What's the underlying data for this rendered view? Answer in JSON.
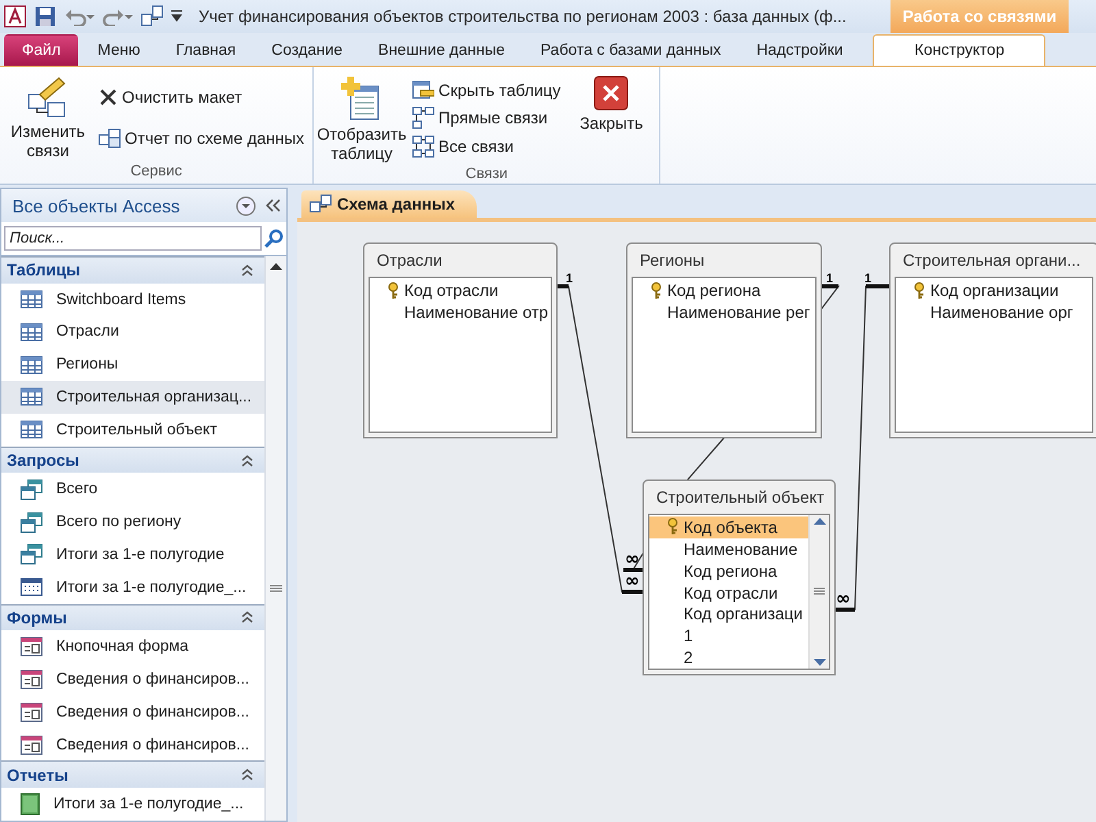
{
  "title_bar": {
    "title": "Учет финансирования объектов строительства по регионам 2003 : база данных (ф...",
    "context_tab": "Работа со связями"
  },
  "tabs": [
    {
      "label": "Файл",
      "kind": "file",
      "selected": false
    },
    {
      "label": "Меню",
      "kind": "tab",
      "selected": false
    },
    {
      "label": "Главная",
      "kind": "tab",
      "selected": false
    },
    {
      "label": "Создание",
      "kind": "tab",
      "selected": false
    },
    {
      "label": "Внешние данные",
      "kind": "tab",
      "selected": false
    },
    {
      "label": "Работа с базами данных",
      "kind": "tab",
      "selected": false
    },
    {
      "label": "Надстройки",
      "kind": "tab",
      "selected": false
    },
    {
      "label": "Конструктор",
      "kind": "tab",
      "selected": true
    }
  ],
  "ribbon": {
    "groups": [
      {
        "label": "Сервис",
        "buttons": [
          {
            "label": "Изменить связи",
            "kind": "large"
          },
          {
            "label": "Очистить макет",
            "kind": "small"
          },
          {
            "label": "Отчет по схеме данных",
            "kind": "small"
          }
        ]
      },
      {
        "label": "Связи",
        "buttons": [
          {
            "label": "Отобразить таблицу",
            "kind": "large"
          },
          {
            "label": "Скрыть таблицу",
            "kind": "small"
          },
          {
            "label": "Прямые связи",
            "kind": "small"
          },
          {
            "label": "Все связи",
            "kind": "small"
          },
          {
            "label": "Закрыть",
            "kind": "large"
          }
        ]
      }
    ]
  },
  "navigation": {
    "title": "Все объекты Access",
    "search": {
      "placeholder": "Поиск..."
    },
    "groups": [
      {
        "label": "Таблицы",
        "expanded": true,
        "items": [
          {
            "label": "Switchboard Items",
            "kind": "table",
            "selected": false
          },
          {
            "label": "Отрасли",
            "kind": "table",
            "selected": false
          },
          {
            "label": "Регионы",
            "kind": "table",
            "selected": false
          },
          {
            "label": "Строительная организац...",
            "kind": "table",
            "selected": true
          },
          {
            "label": "Строительный объект",
            "kind": "table",
            "selected": false
          }
        ]
      },
      {
        "label": "Запросы",
        "expanded": true,
        "items": [
          {
            "label": "Всего",
            "kind": "query",
            "selected": false
          },
          {
            "label": "Всего по региону",
            "kind": "query",
            "selected": false
          },
          {
            "label": "Итоги за 1-е полугодие",
            "kind": "query",
            "selected": false
          },
          {
            "label": "Итоги за 1-е полугодие_...",
            "kind": "crosstab",
            "selected": false
          }
        ]
      },
      {
        "label": "Формы",
        "expanded": true,
        "items": [
          {
            "label": "Кнопочная форма",
            "kind": "form",
            "selected": false
          },
          {
            "label": "Сведения о финансиров...",
            "kind": "form",
            "selected": false
          },
          {
            "label": "Сведения о финансиров...",
            "kind": "form",
            "selected": false
          },
          {
            "label": "Сведения о финансиров...",
            "kind": "form",
            "selected": false
          }
        ]
      },
      {
        "label": "Отчеты",
        "expanded": true,
        "items": [
          {
            "label": "Итоги за 1-е полугодие_...",
            "kind": "report",
            "selected": false
          }
        ]
      }
    ]
  },
  "document": {
    "tab": "Схема данных",
    "tables": [
      {
        "title": "Отрасли",
        "fields": [
          {
            "name": "Код отрасли",
            "key": true,
            "selected": false
          },
          {
            "name": "Наименование отр",
            "key": false,
            "selected": false
          }
        ]
      },
      {
        "title": "Регионы",
        "fields": [
          {
            "name": "Код региона",
            "key": true,
            "selected": false
          },
          {
            "name": "Наименование рег",
            "key": false,
            "selected": false
          }
        ]
      },
      {
        "title": "Строительная органи...",
        "fields": [
          {
            "name": "Код организации",
            "key": true,
            "selected": false
          },
          {
            "name": "Наименование орг",
            "key": false,
            "selected": false
          }
        ]
      },
      {
        "title": "Строительный объект",
        "fields": [
          {
            "name": "Код объекта",
            "key": true,
            "selected": true
          },
          {
            "name": "Наименование",
            "key": false,
            "selected": false
          },
          {
            "name": "Код региона",
            "key": false,
            "selected": false
          },
          {
            "name": "Код отрасли",
            "key": false,
            "selected": false
          },
          {
            "name": "Код организаци",
            "key": false,
            "selected": false
          },
          {
            "name": "1",
            "key": false,
            "selected": false
          },
          {
            "name": "2",
            "key": false,
            "selected": false
          }
        ]
      }
    ],
    "relationships": [
      {
        "one": "1",
        "many": "∞"
      },
      {
        "one": "1",
        "many": "∞"
      },
      {
        "one": "1",
        "many": "∞"
      }
    ]
  }
}
